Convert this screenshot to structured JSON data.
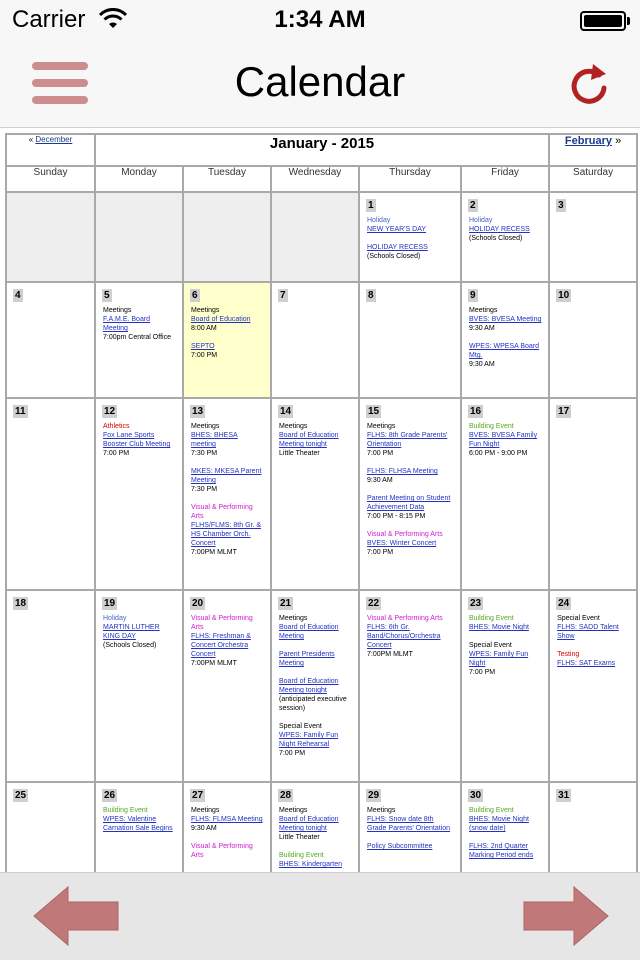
{
  "status": {
    "carrier": "Carrier",
    "time": "1:34 AM"
  },
  "nav": {
    "title": "Calendar"
  },
  "colors": {
    "accent": "#cd8d8d",
    "refresh": "#b22222",
    "arrow": "#c07878"
  },
  "icons": {
    "menu": "hamburger-menu-icon",
    "refresh": "refresh-icon",
    "prev": "arrow-left-icon",
    "next": "arrow-right-icon"
  },
  "calendar": {
    "prev_arrow": "«",
    "prev_label": "December",
    "month": "January - 2015",
    "next_label": "February",
    "next_arrow": "»",
    "weekdays": [
      "Sunday",
      "Monday",
      "Tuesday",
      "Wednesday",
      "Thursday",
      "Friday",
      "Saturday"
    ],
    "weeks": [
      [
        {
          "day": ""
        },
        {
          "day": ""
        },
        {
          "day": ""
        },
        {
          "day": ""
        },
        {
          "day": "1",
          "events": [
            {
              "cat": "Holiday",
              "type": "holiday",
              "link": "NEW YEAR'S DAY"
            },
            {
              "link": "HOLIDAY RECESS",
              "info": "(Schools Closed)"
            }
          ]
        },
        {
          "day": "2",
          "events": [
            {
              "cat": "Holiday",
              "type": "holiday",
              "link": "HOLIDAY RECESS",
              "info": "(Schools Closed)"
            }
          ]
        },
        {
          "day": "3"
        }
      ],
      [
        {
          "day": "4"
        },
        {
          "day": "5",
          "events": [
            {
              "cat": "Meetings",
              "link": "F.A.M.E. Board Meeting",
              "info": "7:00pm Central Office"
            }
          ]
        },
        {
          "day": "6",
          "today": true,
          "events": [
            {
              "cat": "Meetings",
              "link": "Board of Education",
              "info": "8:00 AM"
            },
            {
              "link": "SEPTO",
              "info": "7:00 PM"
            }
          ]
        },
        {
          "day": "7"
        },
        {
          "day": "8"
        },
        {
          "day": "9",
          "events": [
            {
              "cat": "Meetings",
              "link": "BVES: BVESA Meeting",
              "info": "9:30 AM"
            },
            {
              "link": "WPES: WPESA Board Mtg.",
              "info": "9:30 AM"
            }
          ]
        },
        {
          "day": "10"
        }
      ],
      [
        {
          "day": "11"
        },
        {
          "day": "12",
          "events": [
            {
              "cat": "Athletics",
              "type": "athletics",
              "link": "Fox Lane Sports Booster Club Meeting",
              "info": "7:00 PM"
            }
          ]
        },
        {
          "day": "13",
          "events": [
            {
              "cat": "Meetings",
              "link": "BHES: BHESA meeting",
              "info": "7:30 PM"
            },
            {
              "link": "MKES: MKESA Parent Meeting",
              "info": "7:30 PM"
            },
            {
              "cat": "Visual & Performing Arts",
              "type": "arts",
              "link": "FLHS/FLMS: 8th Gr. & HS Chamber Orch. Concert",
              "info": "7:00PM MLMT"
            }
          ]
        },
        {
          "day": "14",
          "events": [
            {
              "cat": "Meetings",
              "link": "Board of Education Meeting tonight",
              "info": "Little Theater"
            }
          ]
        },
        {
          "day": "15",
          "events": [
            {
              "cat": "Meetings",
              "link": "FLHS: 8th Grade Parents' Orientation",
              "info": "7:00 PM"
            },
            {
              "link": "FLHS: FLHSA Meeting",
              "info": "9:30 AM"
            },
            {
              "link": "Parent Meeting on Student Achievement Data",
              "info": "7:00 PM - 8:15 PM"
            },
            {
              "cat": "Visual & Performing Arts",
              "type": "arts",
              "link": "BVES: Winter Concert",
              "info": "7:00 PM"
            }
          ]
        },
        {
          "day": "16",
          "events": [
            {
              "cat": "Building Event",
              "type": "building",
              "link": "BVES: BVESA Family Fun Night",
              "info": "6:00 PM - 9:00 PM"
            }
          ]
        },
        {
          "day": "17"
        }
      ],
      [
        {
          "day": "18"
        },
        {
          "day": "19",
          "events": [
            {
              "cat": "Holiday",
              "type": "holiday",
              "link": "MARTIN LUTHER KING DAY",
              "info": "(Schools Closed)"
            }
          ]
        },
        {
          "day": "20",
          "events": [
            {
              "cat": "Visual & Performing Arts",
              "type": "arts",
              "link": "FLHS: Freshman & Concert Orchestra Concert",
              "info": "7:00PM MLMT"
            }
          ]
        },
        {
          "day": "21",
          "events": [
            {
              "cat": "Meetings",
              "link": "Board of Education Meeting"
            },
            {
              "link": "Parent Presidents Meeting"
            },
            {
              "link": "Board of Education Meeting tonight",
              "info": "(anticipated executive session)"
            },
            {
              "cat": "Special Event",
              "link": "WPES: Family Fun Night Rehearsal",
              "info": "7:00 PM"
            }
          ]
        },
        {
          "day": "22",
          "events": [
            {
              "cat": "Visual & Performing Arts",
              "type": "arts",
              "link": "FLHS: 6th Gr. Band/Chorus/Orchestra Concert",
              "info": "7:00PM MLMT"
            }
          ]
        },
        {
          "day": "23",
          "events": [
            {
              "cat": "Building Event",
              "type": "building",
              "link": "BHES: Movie Night"
            },
            {
              "cat": "Special Event",
              "link": "WPES: Family Fun Night",
              "info": "7:00 PM"
            }
          ]
        },
        {
          "day": "24",
          "events": [
            {
              "cat": "Special Event",
              "link": "FLHS: SADD Talent Show"
            },
            {
              "cat": "Testing",
              "type": "testing",
              "link": "FLHS: SAT Exams"
            }
          ]
        }
      ],
      [
        {
          "day": "25"
        },
        {
          "day": "26",
          "events": [
            {
              "cat": "Building Event",
              "type": "building",
              "link": "WPES: Valentine Carnation Sale Begins"
            }
          ]
        },
        {
          "day": "27",
          "events": [
            {
              "cat": "Meetings",
              "link": "FLHS: FLMSA Meeting",
              "info": "9:30 AM"
            },
            {
              "cat": "Visual & Performing Arts",
              "type": "arts"
            }
          ]
        },
        {
          "day": "28",
          "events": [
            {
              "cat": "Meetings",
              "link": "Board of Education Meeting tonight",
              "info": "Little Theater"
            },
            {
              "cat": "Building Event",
              "type": "building",
              "link": "BHES: Kindergarten"
            }
          ]
        },
        {
          "day": "29",
          "events": [
            {
              "cat": "Meetings",
              "link": "FLHS: Snow date 8th Grade Parents' Orientation"
            },
            {
              "link": "Policy Subcommittee"
            }
          ]
        },
        {
          "day": "30",
          "events": [
            {
              "cat": "Building Event",
              "type": "building",
              "link": "BHES: Movie Night (snow date)"
            },
            {
              "link": "FLHS: 2nd Quarter Marking Period ends"
            }
          ]
        },
        {
          "day": "31"
        }
      ]
    ]
  }
}
